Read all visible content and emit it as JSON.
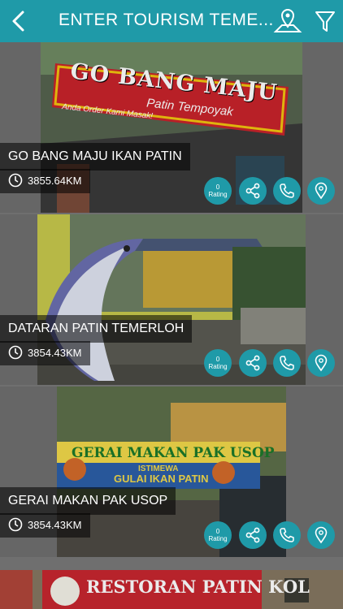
{
  "header": {
    "title": "ENTER TOURISM TEME...",
    "back_icon": "chevron-left-icon",
    "map_icon": "map-pin-icon",
    "filter_icon": "filter-icon"
  },
  "listings": [
    {
      "name": "GO BANG MAJU IKAN PATIN",
      "distance": "3855.64KM",
      "rating_value": "0",
      "rating_label": "Rating",
      "sign_text": "GO BANG MAJU",
      "sign_sub": "Patin Tempoyak",
      "sign_note": "Anda Order Kami Masak!"
    },
    {
      "name": "DATARAN PATIN TEMERLOH",
      "distance": "3854.43KM",
      "rating_value": "0",
      "rating_label": "Rating"
    },
    {
      "name": "GERAI MAKAN PAK USOP",
      "distance": "3854.43KM",
      "rating_value": "0",
      "rating_label": "Rating",
      "sign_text": "GERAI MAKAN PAK USOP",
      "sign_sub": "ISTIMEWA",
      "sign_sub2": "GULAI IKAN PATIN"
    },
    {
      "sign_text": "RESTORAN PATIN KOL"
    }
  ],
  "colors": {
    "accent": "#1f9aa8",
    "background": "#6f6f6f"
  }
}
